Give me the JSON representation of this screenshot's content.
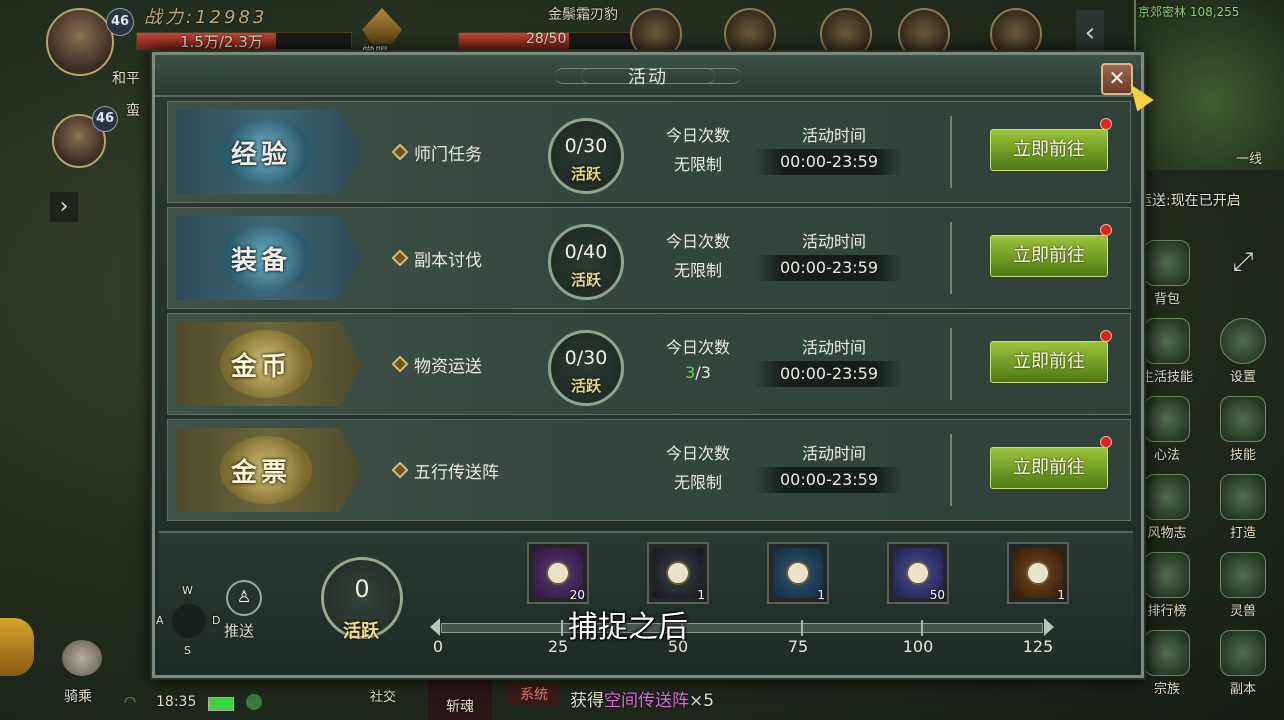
{
  "hud": {
    "player1_level": "46",
    "power_label": "战力:12983",
    "hp_text": "1.5万/2.3万",
    "player1_name": "和平",
    "player2_level": "46",
    "player2_name": "蛮",
    "target_name": "金鬃霜刃豹",
    "target_hp": "28/50",
    "bounty_label": "赏赐",
    "map_location": "京郊密林 108,255",
    "line_label": "一线",
    "transport_notice": "运送:现在已开启",
    "side_buttons": [
      "背包",
      "生活技能",
      "设置",
      "心法",
      "技能",
      "风物志",
      "打造",
      "排行榜",
      "灵兽",
      "宗族",
      "副本"
    ],
    "joystick": {
      "w": "W",
      "a": "A",
      "s": "S",
      "d": "D"
    },
    "push_label": "推送",
    "mount_label": "骑乘",
    "time": "18:35",
    "social_label": "社交",
    "soul_label": "斩魂",
    "system_tag": "系统",
    "system_msg_prefix": "获得",
    "system_msg_item": "空间传送阵",
    "system_msg_suffix": "×5",
    "subtitle": "捕捉之后"
  },
  "dialog": {
    "title": "活动",
    "close_symbol": "✕",
    "activities": [
      {
        "category": "经验",
        "name": "师门任务",
        "vitality": "0/30",
        "vitality_tag": "活跃",
        "count_header": "今日次数",
        "count_value": "无限制",
        "time_header": "活动时间",
        "time_value": "00:00-23:59",
        "button": "立即前往",
        "style": "blue"
      },
      {
        "category": "装备",
        "name": "副本讨伐",
        "vitality": "0/40",
        "vitality_tag": "活跃",
        "count_header": "今日次数",
        "count_value": "无限制",
        "time_header": "活动时间",
        "time_value": "00:00-23:59",
        "button": "立即前往",
        "style": "blue"
      },
      {
        "category": "金币",
        "name": "物资运送",
        "vitality": "0/30",
        "vitality_tag": "活跃",
        "count_header": "今日次数",
        "count_done": "3",
        "count_total": "/3",
        "time_header": "活动时间",
        "time_value": "00:00-23:59",
        "button": "立即前往",
        "style": "gold"
      },
      {
        "category": "金票",
        "name": "五行传送阵",
        "count_header": "今日次数",
        "count_value": "无限制",
        "time_header": "活动时间",
        "time_value": "00:00-23:59",
        "button": "立即前往",
        "style": "gold"
      }
    ],
    "total_vitality": "0",
    "total_vitality_tag": "活跃",
    "progress": {
      "min": 0,
      "max": 125,
      "value": 0,
      "ticks": [
        "0",
        "25",
        "50",
        "75",
        "100",
        "125"
      ]
    },
    "rewards": [
      {
        "qty": "20",
        "colors": [
          "#5b3a7a",
          "#2a1838"
        ]
      },
      {
        "qty": "1",
        "colors": [
          "#3a3f48",
          "#15181d"
        ]
      },
      {
        "qty": "1",
        "colors": [
          "#2d5a76",
          "#14283a"
        ]
      },
      {
        "qty": "50",
        "colors": [
          "#4a4fa0",
          "#1d1f44"
        ]
      },
      {
        "qty": "1",
        "colors": [
          "#7a4a1d",
          "#2e1a0a"
        ]
      }
    ],
    "accent_green": "#5fdc3c",
    "button_color": "#7aa82a"
  }
}
